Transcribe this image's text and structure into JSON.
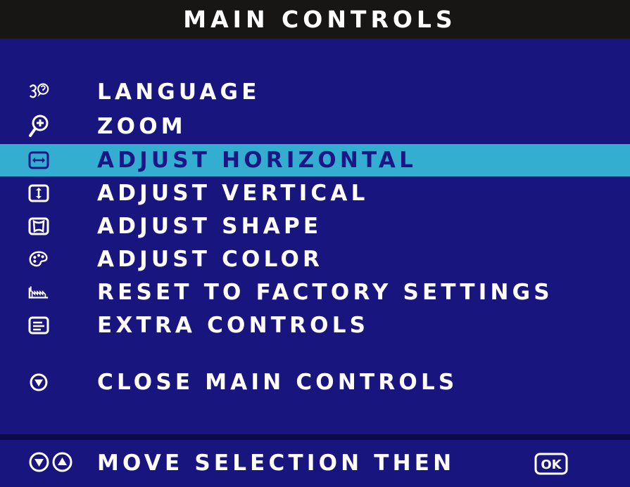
{
  "title": "MAIN CONTROLS",
  "menu": {
    "items": [
      {
        "label": "LANGUAGE",
        "icon": "language-icon",
        "selected": false
      },
      {
        "label": "ZOOM",
        "icon": "zoom-icon",
        "selected": false
      },
      {
        "label": "ADJUST HORIZONTAL",
        "icon": "horizontal-arrows-icon",
        "selected": true
      },
      {
        "label": "ADJUST VERTICAL",
        "icon": "vertical-arrows-icon",
        "selected": false
      },
      {
        "label": "ADJUST SHAPE",
        "icon": "shape-icon",
        "selected": false
      },
      {
        "label": "ADJUST COLOR",
        "icon": "palette-icon",
        "selected": false
      },
      {
        "label": "RESET TO FACTORY SETTINGS",
        "icon": "factory-icon",
        "selected": false
      },
      {
        "label": "EXTRA CONTROLS",
        "icon": "extra-controls-icon",
        "selected": false
      }
    ],
    "close": {
      "label": "CLOSE MAIN CONTROLS",
      "icon": "down-arrow-circle-icon"
    }
  },
  "footer": {
    "hint": "MOVE SELECTION THEN",
    "nav_icons": [
      "down-arrow-circle-icon",
      "up-arrow-circle-icon"
    ],
    "ok_label": "OK"
  },
  "colors": {
    "background": "#19157f",
    "title_bar": "#181515",
    "selection": "#33aed1",
    "selected_text": "#1a1686",
    "text": "#ffffff"
  }
}
